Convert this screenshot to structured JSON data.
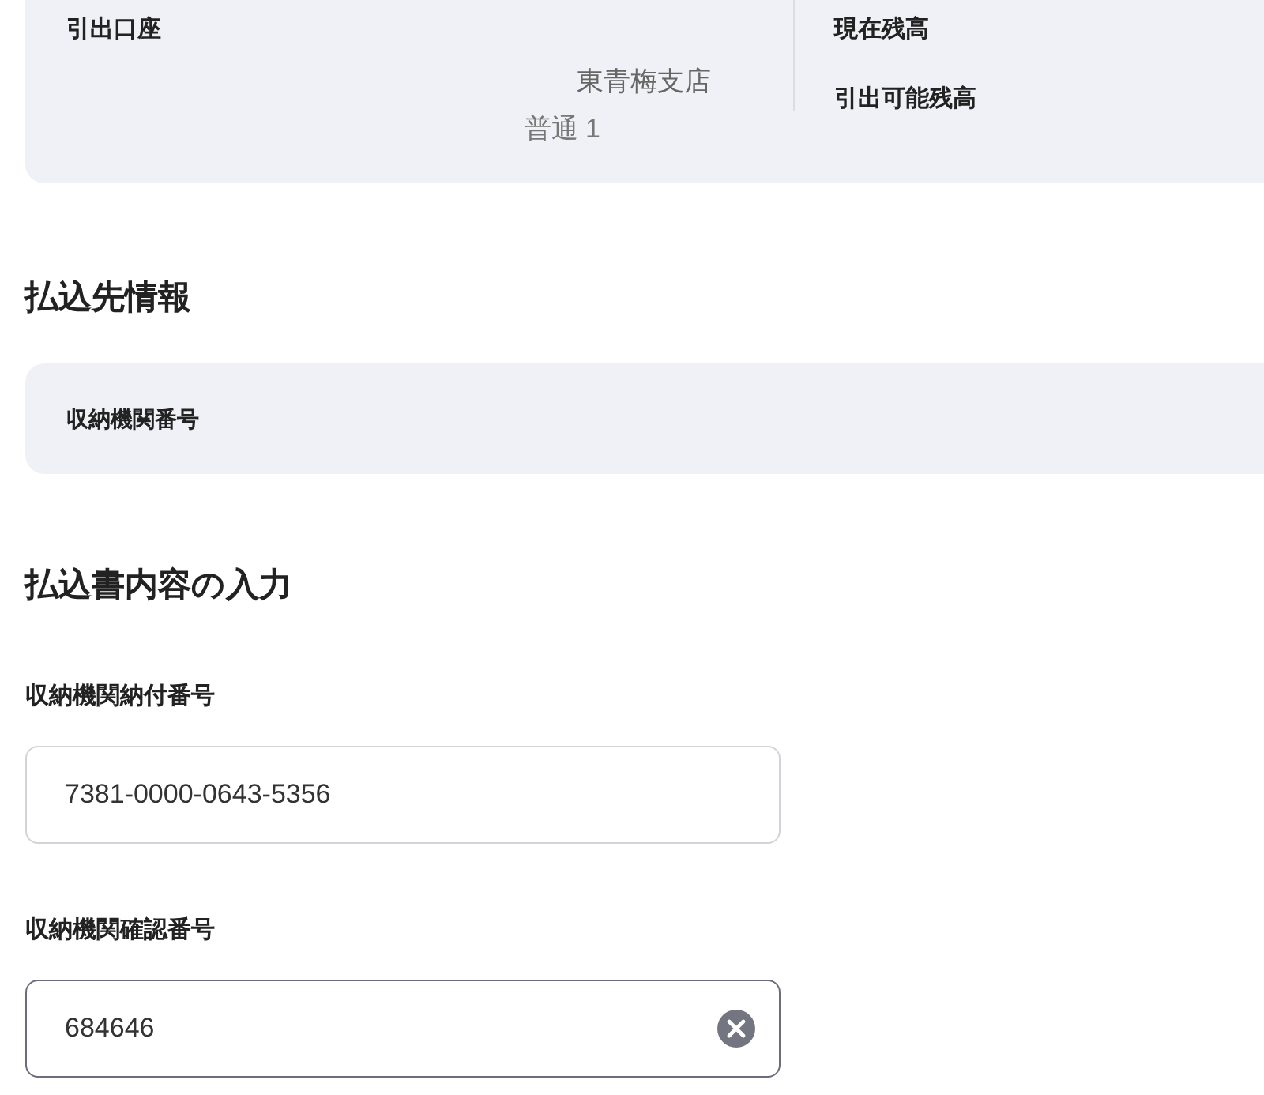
{
  "account_card": {
    "label": "引出口座",
    "branch": "東青梅支店",
    "account": "普通 1",
    "balance_labels": [
      "現在残高",
      "引出可能残高"
    ]
  },
  "payee_section": {
    "heading": "払込先情報",
    "label": "収納機関番号"
  },
  "input_section": {
    "heading": "払込書内容の入力",
    "fields": [
      {
        "label": "収納機関納付番号",
        "value": "7381-0000-0643-5356",
        "focused": false
      },
      {
        "label": "収納機関確認番号",
        "value": "684646",
        "focused": true
      }
    ]
  }
}
